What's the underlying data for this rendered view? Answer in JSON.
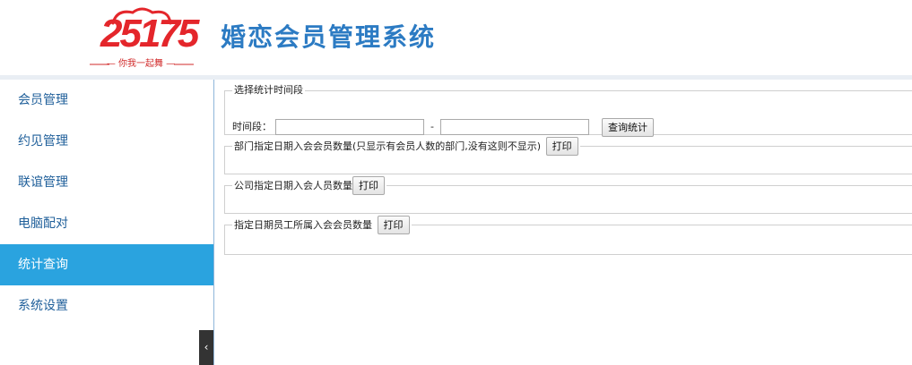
{
  "header": {
    "logo_number": "25175",
    "logo_slogan": "— 你我一起舞 —",
    "app_title": "婚恋会员管理系统"
  },
  "sidebar": {
    "items": [
      {
        "label": "会员管理",
        "active": false
      },
      {
        "label": "约见管理",
        "active": false
      },
      {
        "label": "联谊管理",
        "active": false
      },
      {
        "label": "电脑配对",
        "active": false
      },
      {
        "label": "统计查询",
        "active": true
      },
      {
        "label": "系统设置",
        "active": false
      }
    ],
    "collapse_glyph": "‹"
  },
  "main": {
    "period_section": {
      "legend": "选择统计时间段",
      "label": "时间段：",
      "start_value": "",
      "separator": "-",
      "end_value": "",
      "query_button": "查询统计"
    },
    "dept_section": {
      "legend": "部门指定日期入会会员数量(只显示有会员人数的部门,没有这则不显示)",
      "print_button": "打印"
    },
    "company_section": {
      "legend": "公司指定日期入会人员数量",
      "print_button": "打印"
    },
    "staff_section": {
      "legend": "指定日期员工所属入会会员数量",
      "print_button": "打印"
    }
  },
  "colors": {
    "title_blue": "#2c7bc3",
    "menu_text": "#1f5f9a",
    "active_bg": "#2aa3df",
    "logo_red": "#e4262b"
  }
}
